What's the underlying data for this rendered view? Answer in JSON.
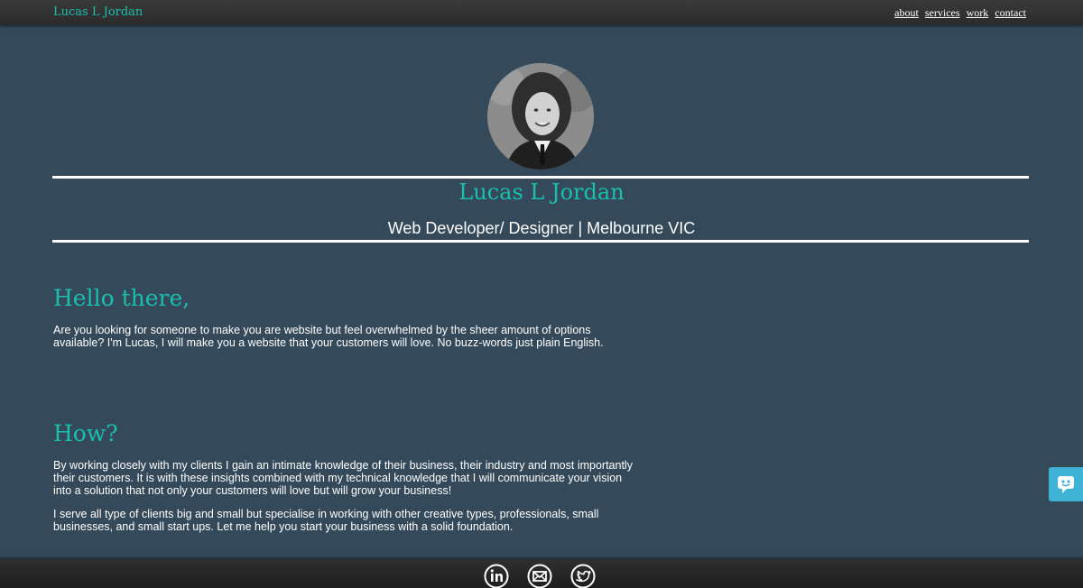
{
  "header": {
    "brand": "Lucas L Jordan",
    "nav": [
      "about",
      "services",
      "work",
      "contact"
    ]
  },
  "hero": {
    "name": "Lucas L Jordan",
    "subtitle": "Web Developer/ Designer | Melbourne VIC"
  },
  "sections": [
    {
      "heading": "Hello there,",
      "paragraphs": [
        "Are you looking for someone to make you are website but feel overwhelmed by the sheer amount of options available? I'm Lucas, I will make you a website that your customers will love. No buzz-words just plain English."
      ]
    },
    {
      "heading": "How?",
      "paragraphs": [
        "By working closely with my clients I gain an intimate knowledge of their business, their industry and most importantly their customers. It is with these insights combined with my technical knowledge that I will communicate your vision into a solution that not only your customers will love but will grow your business!",
        "I serve all type of clients big and small but specialise in working with other creative types, professionals, small businesses, and small start ups. Let me help you start your business with a solid foundation."
      ]
    }
  ],
  "footer": {
    "social_icons": [
      "linkedin-icon",
      "mail-icon",
      "twitter-icon"
    ]
  },
  "colors": {
    "background": "#34495a",
    "accent": "#1bbfae",
    "chat": "#3fb3d6"
  }
}
